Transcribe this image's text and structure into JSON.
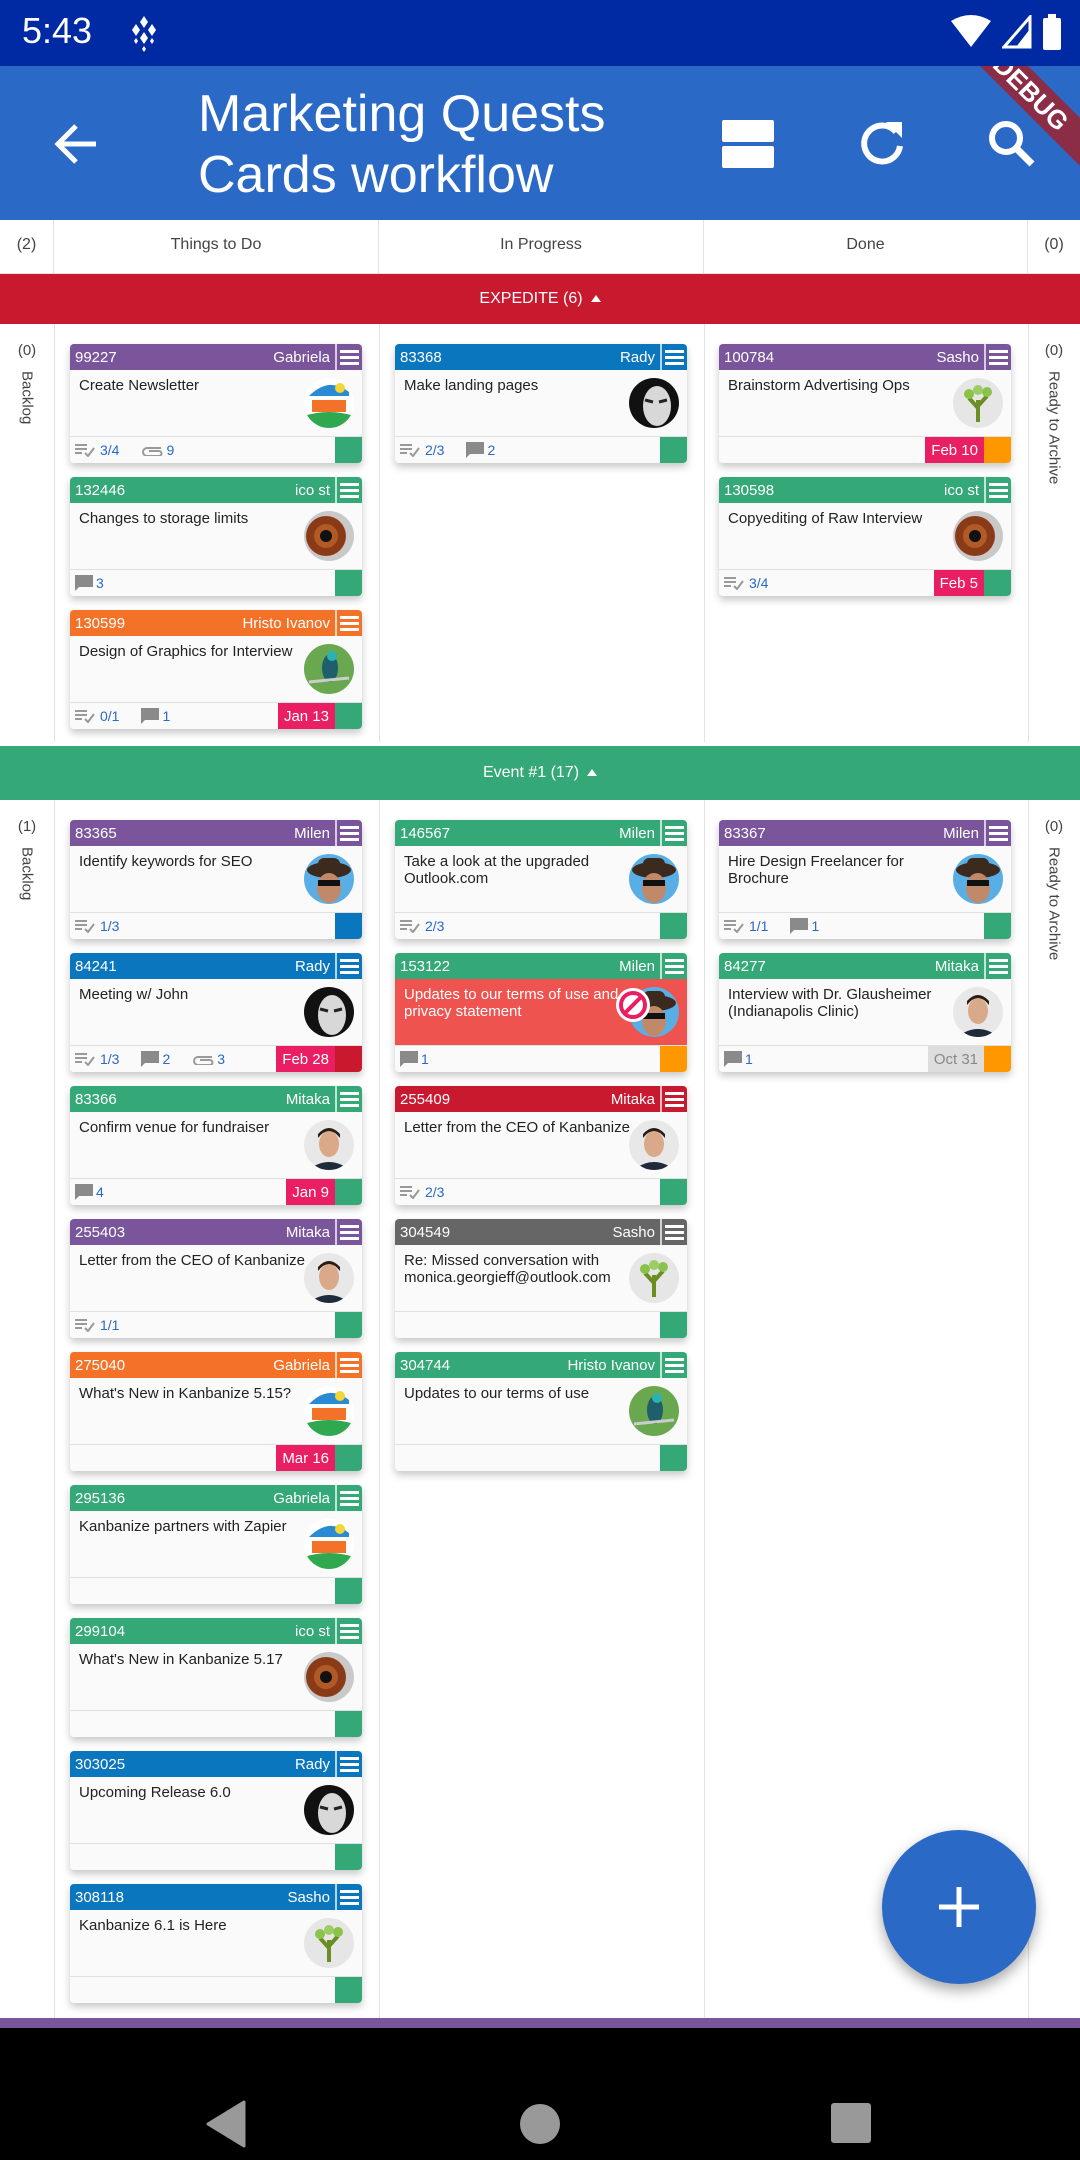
{
  "status_bar": {
    "time": "5:43"
  },
  "app_bar": {
    "title_line1": "Marketing Quests",
    "title_line2": "Cards workflow",
    "debug_banner": "DEBUG"
  },
  "columns": {
    "left_count": "(2)",
    "headers": [
      "Things to Do",
      "In Progress",
      "Done"
    ],
    "right_count": "(0)"
  },
  "lanes": [
    {
      "label": "EXPEDITE (6)",
      "color": "#c8192f",
      "backlog_count": "(0)",
      "backlog_label": "Backlog",
      "archive_count": "(0)",
      "archive_label": "Ready to Archive",
      "columns": [
        [
          {
            "id": "99227",
            "owner": "Gabriela",
            "color": "#7b559c",
            "title": "Create Newsletter",
            "avatar": "fox",
            "subtasks": "3/4",
            "attachments": "9",
            "block": "#35a877"
          },
          {
            "id": "132446",
            "owner": "ico st",
            "color": "#35a877",
            "title": "Changes to storage limits",
            "avatar": "eye",
            "comments": "3",
            "block": "#35a877"
          },
          {
            "id": "130599",
            "owner": "Hristo Ivanov",
            "color": "#f37227",
            "title": "Design of Graphics for Interview",
            "avatar": "bird",
            "subtasks": "0/1",
            "comments": "1",
            "due": "Jan 13",
            "block": "#35a877"
          }
        ],
        [
          {
            "id": "83368",
            "owner": "Rady",
            "color": "#0a76bd",
            "title": "Make landing pages",
            "avatar": "woman",
            "subtasks": "2/3",
            "comments": "2",
            "block": "#35a877"
          }
        ],
        [
          {
            "id": "100784",
            "owner": "Sasho",
            "color": "#7b559c",
            "title": "Brainstorm Advertising Ops",
            "avatar": "tree",
            "due": "Feb 10",
            "block": "#ff9800"
          },
          {
            "id": "130598",
            "owner": "ico st",
            "color": "#35a877",
            "title": "Copyediting of Raw Interview",
            "avatar": "eye",
            "subtasks": "3/4",
            "due": "Feb 5",
            "block": "#35a877"
          }
        ]
      ]
    },
    {
      "label": "Event #1 (17)",
      "color": "#35a877",
      "backlog_count": "(1)",
      "backlog_label": "Backlog",
      "archive_count": "(0)",
      "archive_label": "Ready to Archive",
      "columns": [
        [
          {
            "id": "83365",
            "owner": "Milen",
            "color": "#7b559c",
            "title": "Identify keywords for SEO",
            "avatar": "hat",
            "subtasks": "1/3",
            "block": "#0a76bd"
          },
          {
            "id": "84241",
            "owner": "Rady",
            "color": "#0a76bd",
            "title": "Meeting w/ John",
            "avatar": "woman",
            "subtasks": "1/3",
            "comments": "2",
            "attachments": "3",
            "due": "Feb 28",
            "block": "#c8192f"
          },
          {
            "id": "83366",
            "owner": "Mitaka",
            "color": "#35a877",
            "title": "Confirm venue for fundraiser",
            "avatar": "man",
            "comments": "4",
            "due": "Jan 9",
            "block": "#35a877"
          },
          {
            "id": "255403",
            "owner": "Mitaka",
            "color": "#7b559c",
            "title": "Letter from the CEO of Kanbanize",
            "avatar": "man",
            "subtasks": "1/1",
            "block": "#35a877"
          },
          {
            "id": "275040",
            "owner": "Gabriela",
            "color": "#f37227",
            "title": "What's New in Kanbanize 5.15?",
            "avatar": "fox",
            "due": "Mar 16",
            "block": "#35a877"
          },
          {
            "id": "295136",
            "owner": "Gabriela",
            "color": "#35a877",
            "title": "Kanbanize partners with Zapier",
            "avatar": "fox",
            "block": "#35a877"
          },
          {
            "id": "299104",
            "owner": "ico st",
            "color": "#35a877",
            "title": "What's New in Kanbanize 5.17",
            "avatar": "eye",
            "block": "#35a877"
          },
          {
            "id": "303025",
            "owner": "Rady",
            "color": "#0a76bd",
            "title": "Upcoming Release 6.0",
            "avatar": "woman",
            "block": "#35a877"
          },
          {
            "id": "308118",
            "owner": "Sasho",
            "color": "#0a76bd",
            "title": "Kanbanize 6.1 is Here",
            "avatar": "tree",
            "block": "#35a877"
          }
        ],
        [
          {
            "id": "146567",
            "owner": "Milen",
            "color": "#35a877",
            "title": "Take a look at the upgraded Outlook.com",
            "avatar": "hat",
            "subtasks": "2/3",
            "block": "#35a877"
          },
          {
            "id": "153122",
            "owner": "Milen",
            "color": "#35a877",
            "title": "Updates to our terms of use and privacy statement",
            "avatar": "hat",
            "blocked": true,
            "comments": "1",
            "block": "#ff9800"
          },
          {
            "id": "255409",
            "owner": "Mitaka",
            "color": "#c8192f",
            "title": "Letter from the CEO of Kanbanize",
            "avatar": "man",
            "subtasks": "2/3",
            "block": "#35a877"
          },
          {
            "id": "304549",
            "owner": "Sasho",
            "color": "#666666",
            "title": "Re: Missed conversation with monica.georgieff@outlook.com",
            "avatar": "tree",
            "block": "#35a877"
          },
          {
            "id": "304744",
            "owner": "Hristo Ivanov",
            "color": "#35a877",
            "title": "Updates to our terms of use",
            "avatar": "bird",
            "block": "#35a877"
          }
        ],
        [
          {
            "id": "83367",
            "owner": "Milen",
            "color": "#7b559c",
            "title": "Hire Design Freelancer for Brochure",
            "avatar": "hat",
            "subtasks": "1/1",
            "comments": "1",
            "block": "#35a877"
          },
          {
            "id": "84277",
            "owner": "Mitaka",
            "color": "#35a877",
            "title": "Interview with Dr. Glausheimer (Indianapolis Clinic)",
            "avatar": "man",
            "comments": "1",
            "due": "Oct 31",
            "due_past": true,
            "block": "#ff9800"
          }
        ]
      ]
    }
  ],
  "fab": {
    "icon": "plus-icon"
  },
  "colors": {
    "status_bar": "#002aa3",
    "app_bar": "#2a69c6",
    "expedite": "#c8192f",
    "event": "#35a877"
  }
}
